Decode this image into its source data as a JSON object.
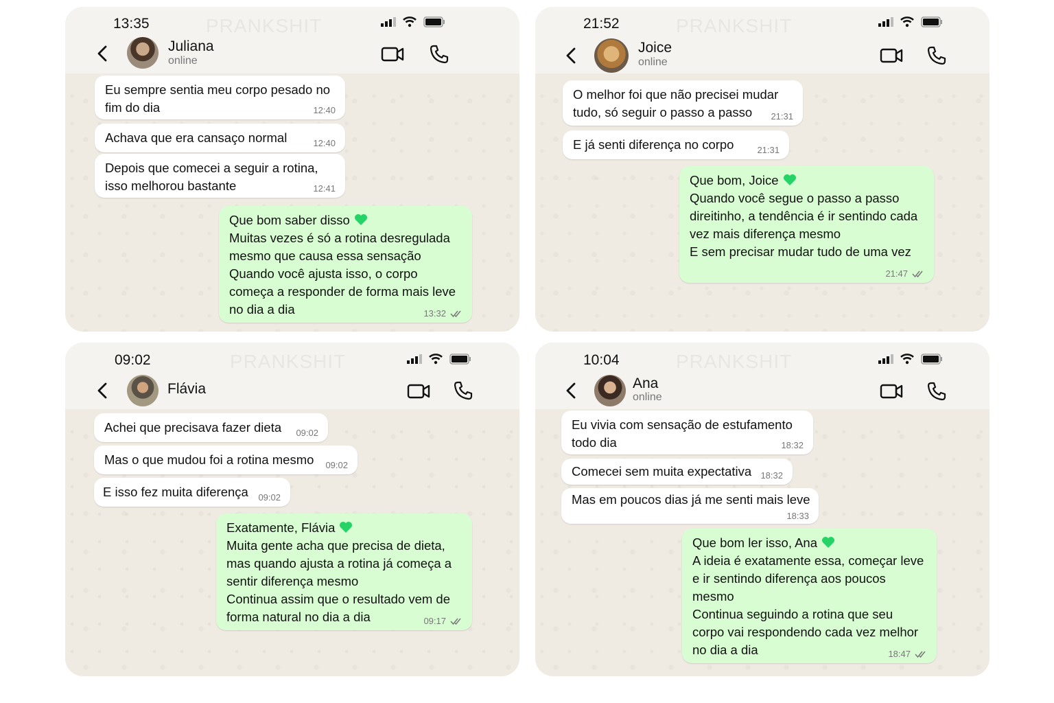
{
  "watermark": "PRANKSHIT",
  "colors": {
    "incoming": "#ffffff",
    "outgoing": "#d9fdd3",
    "heart": "#25d366",
    "wallpaper": "#efeae2"
  },
  "chats": [
    {
      "status_time": "13:35",
      "contact": {
        "name": "Juliana",
        "status": "online"
      },
      "messages": [
        {
          "direction": "in",
          "lines": [
            "Eu sempre sentia meu corpo pesado no",
            "fim do dia"
          ],
          "time": "12:40"
        },
        {
          "direction": "in",
          "lines": [
            "Achava que era cansaço normal"
          ],
          "time": "12:40"
        },
        {
          "direction": "in",
          "lines": [
            "Depois que comecei a seguir a rotina,",
            "isso melhorou bastante"
          ],
          "time": "12:41"
        },
        {
          "direction": "out",
          "lines": [
            "Que bom saber disso",
            "Muitas vezes é só a rotina desregulada",
            "mesmo que causa essa sensação",
            "Quando você ajusta isso, o corpo",
            "começa a responder de forma mais leve",
            "no dia a dia"
          ],
          "time": "13:32"
        }
      ]
    },
    {
      "status_time": "21:52",
      "contact": {
        "name": "Joice",
        "status": "online"
      },
      "messages": [
        {
          "direction": "in",
          "lines": [
            "O melhor foi que não precisei mudar",
            "tudo, só seguir o passo a passo"
          ],
          "time": "21:31"
        },
        {
          "direction": "in",
          "lines": [
            "E já senti diferença no corpo"
          ],
          "time": "21:31"
        },
        {
          "direction": "out",
          "lines": [
            "Que bom, Joice",
            "Quando você segue o passo a passo",
            "direitinho, a tendência é ir sentindo cada",
            "vez mais diferença mesmo",
            "E sem precisar mudar tudo de uma vez"
          ],
          "time": "21:47"
        }
      ]
    },
    {
      "status_time": "09:02",
      "contact": {
        "name": "Flávia",
        "status": ""
      },
      "messages": [
        {
          "direction": "in",
          "lines": [
            "Achei que precisava fazer dieta"
          ],
          "time": "09:02"
        },
        {
          "direction": "in",
          "lines": [
            "Mas o que mudou foi a rotina mesmo"
          ],
          "time": "09:02"
        },
        {
          "direction": "in",
          "lines": [
            "E isso fez muita diferença"
          ],
          "time": "09:02"
        },
        {
          "direction": "out",
          "lines": [
            "Exatamente, Flávia",
            "Muita gente acha que precisa de dieta,",
            "mas quando ajusta a rotina já começa a",
            "sentir diferença mesmo",
            "Continua assim que o resultado vem de",
            "forma natural no dia a dia"
          ],
          "time": "09:17"
        }
      ]
    },
    {
      "status_time": "10:04",
      "contact": {
        "name": "Ana",
        "status": "online"
      },
      "messages": [
        {
          "direction": "in",
          "lines": [
            "Eu vivia com sensação de estufamento",
            "todo dia"
          ],
          "time": "18:32"
        },
        {
          "direction": "in",
          "lines": [
            "Comecei sem muita expectativa"
          ],
          "time": "18:32"
        },
        {
          "direction": "in",
          "lines": [
            "Mas em poucos dias já me senti mais leve"
          ],
          "time": "18:33"
        },
        {
          "direction": "out",
          "lines": [
            "Que bom ler isso, Ana",
            "A ideia é exatamente essa, começar leve",
            "e ir sentindo diferença aos poucos",
            "mesmo",
            "Continua seguindo a rotina que seu",
            "corpo vai respondendo cada vez melhor",
            "no dia a dia"
          ],
          "time": "18:47"
        }
      ]
    }
  ]
}
